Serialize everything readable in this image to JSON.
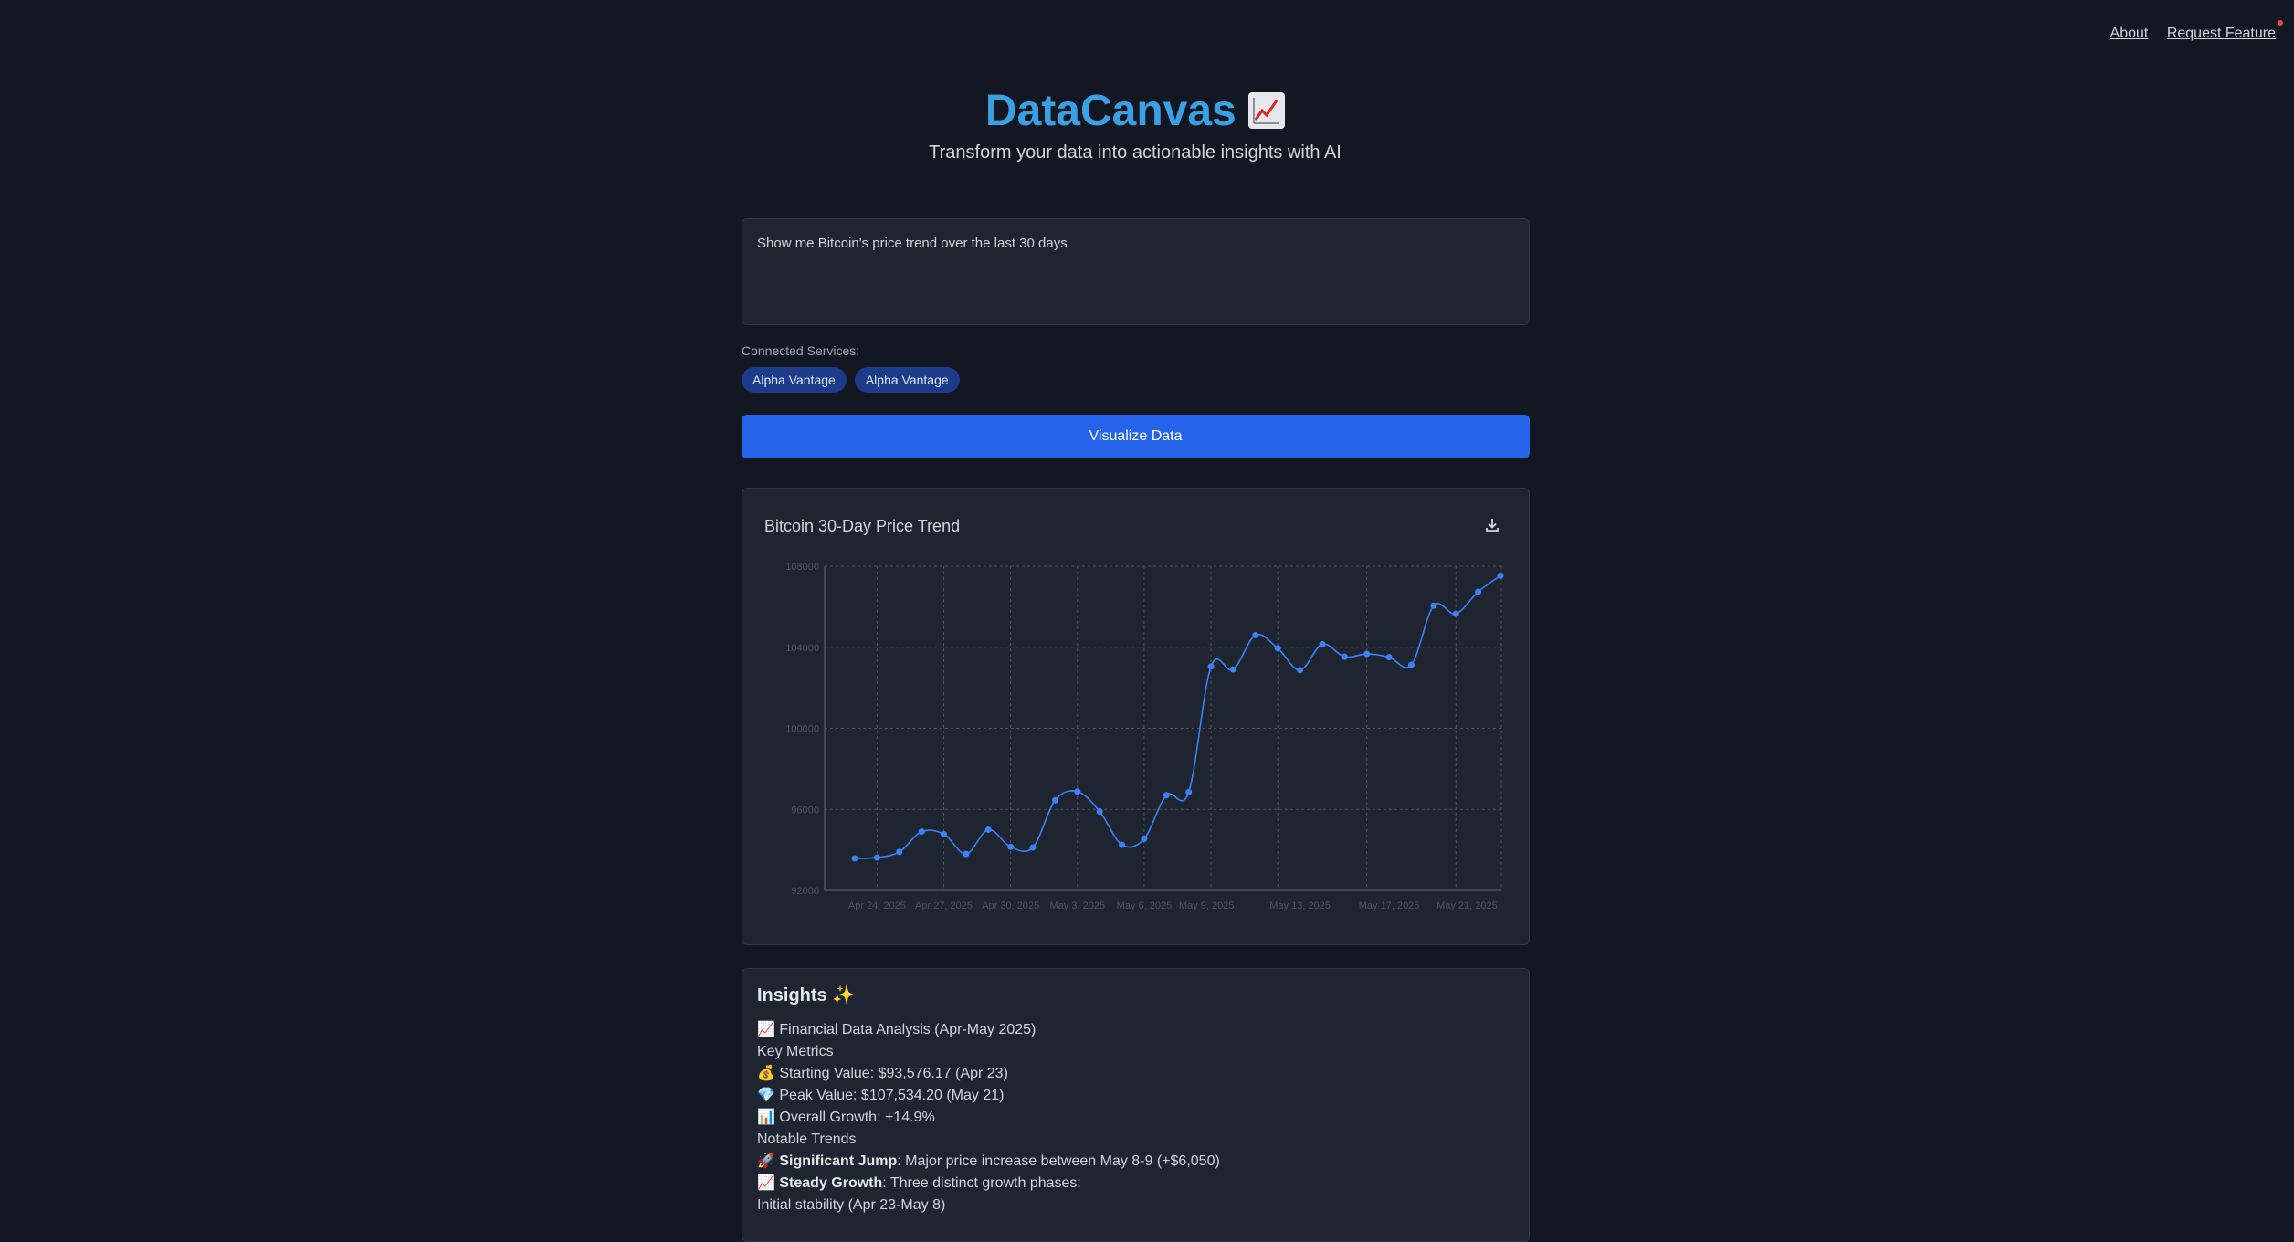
{
  "nav": {
    "about": "About",
    "request": "Request Feature"
  },
  "hero": {
    "title": "DataCanvas",
    "subtitle": "Transform your data into actionable insights with AI"
  },
  "prompt": {
    "value": "Show me Bitcoin's price trend over the last 30 days"
  },
  "services": {
    "label": "Connected Services:",
    "chips": [
      "Alpha Vantage",
      "Alpha Vantage"
    ]
  },
  "visualize_label": "Visualize Data",
  "chart_card": {
    "title": "Bitcoin 30-Day Price Trend"
  },
  "chart_data": {
    "type": "line",
    "title": "Bitcoin 30-Day Price Trend",
    "xlabel": "",
    "ylabel": "",
    "ylim": [
      92000,
      108000
    ],
    "y_ticks": [
      "92000",
      "96000",
      "100000",
      "104000",
      "108000"
    ],
    "x_tick_labels": [
      "Apr 24, 2025",
      "Apr 27, 2025",
      "Apr 30, 2025",
      "May 3, 2025",
      "May 6, 2025",
      "May 9, 2025",
      "May 13, 2025",
      "May 17, 2025",
      "May 21, 2025"
    ],
    "grid": true,
    "series": [
      {
        "color": "#3b82f6",
        "values": [
          93576,
          93620,
          93900,
          94900,
          94780,
          93800,
          95000,
          94150,
          94120,
          96450,
          96880,
          95900,
          94250,
          94550,
          96700,
          96850,
          103050,
          102900,
          104600,
          103950,
          102870,
          104150,
          103530,
          103670,
          103510,
          103130,
          106050,
          105650,
          106740,
          107534
        ]
      }
    ]
  },
  "insights": {
    "heading": "Insights",
    "title": "Financial Data Analysis (Apr-May 2025)",
    "key_metrics": "Key Metrics",
    "starting": "Starting Value: $93,576.17 (Apr 23)",
    "peak": "Peak Value: $107,534.20 (May 21)",
    "growth": "Overall Growth: +14.9%",
    "notable": "Notable Trends",
    "jump_label": "Significant Jump",
    "jump_text": ": Major price increase between May 8-9 (+$6,050)",
    "steady_label": "Steady Growth",
    "steady_text": ": Three distinct growth phases:",
    "phase1": "Initial stability (Apr 23-May 8)"
  }
}
